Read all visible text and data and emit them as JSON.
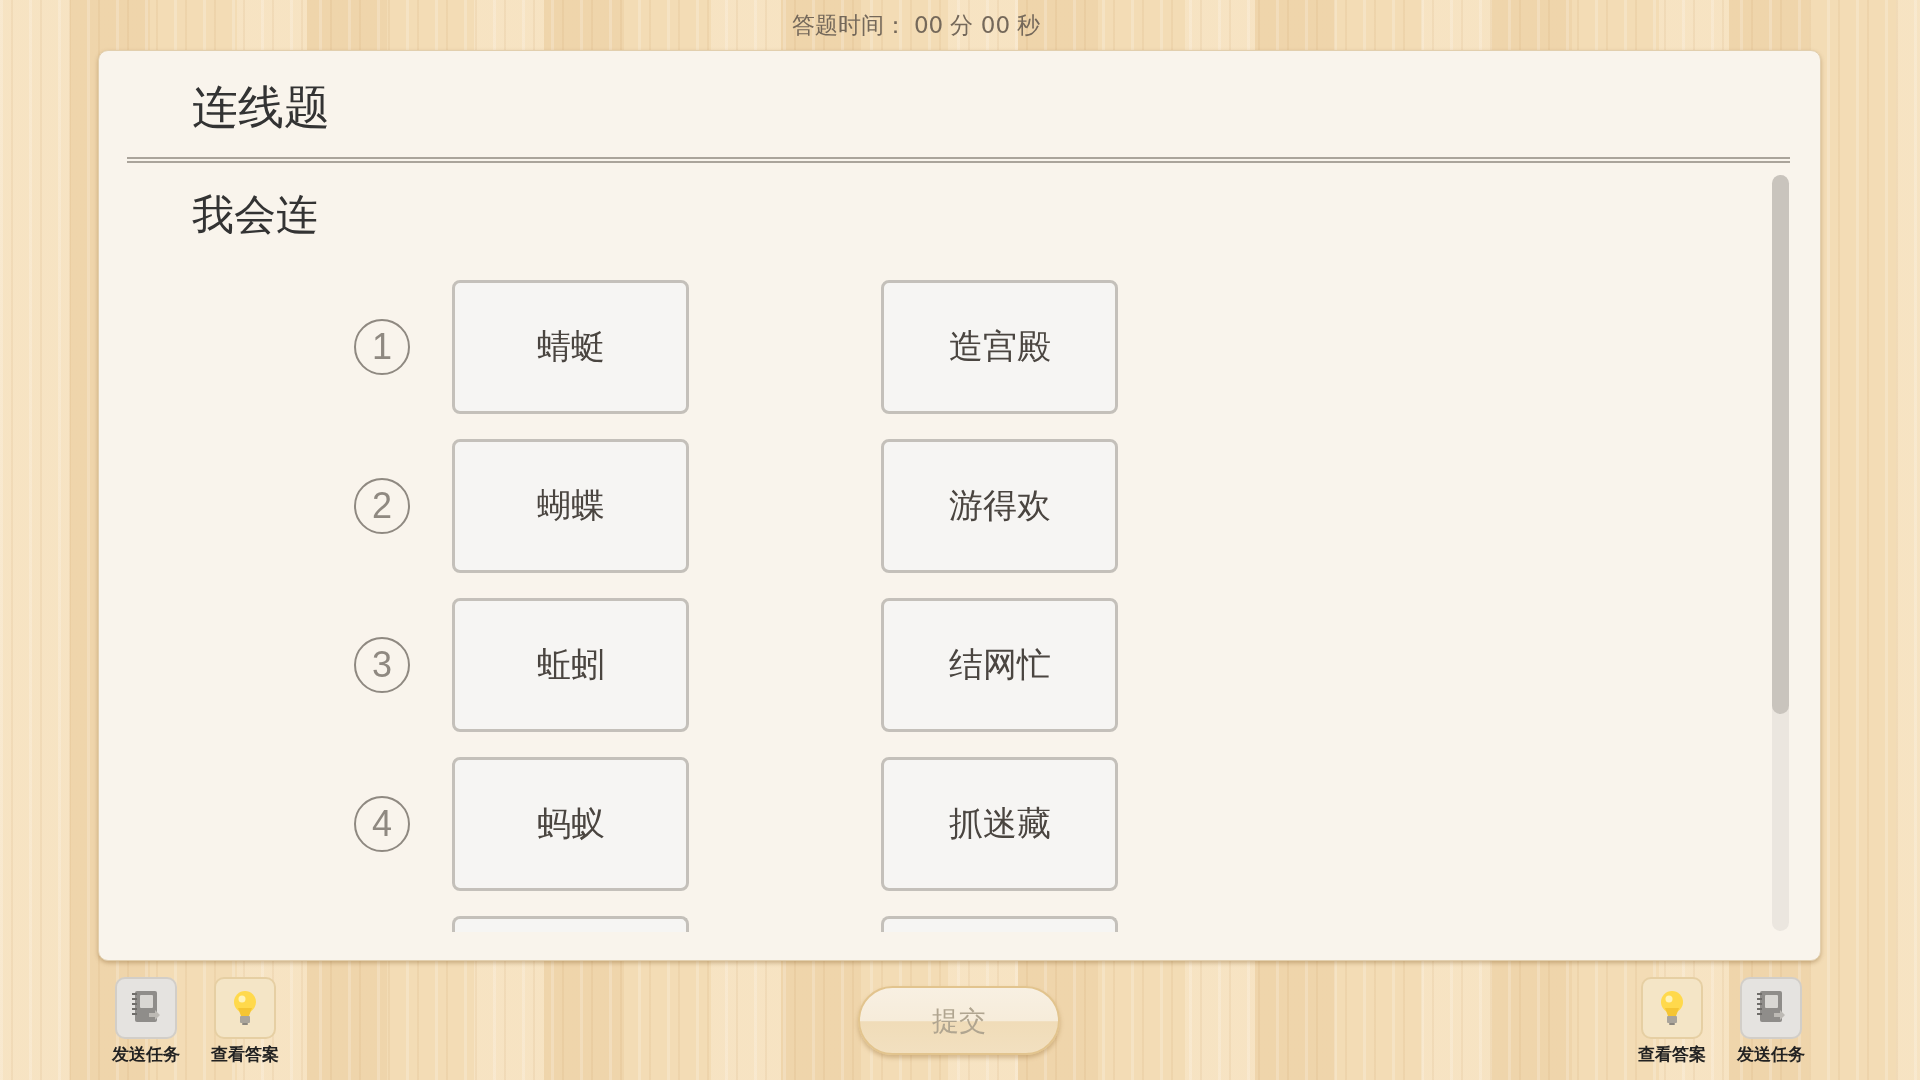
{
  "timer": "答题时间： 00 分 00 秒",
  "question": {
    "type_title": "连线题",
    "prompt": "我会连",
    "pairs": [
      {
        "number": "1",
        "left": {
          "text": "蜻蜓",
          "selected": false
        },
        "right": {
          "text": "造宫殿",
          "selected": false
        }
      },
      {
        "number": "2",
        "left": {
          "text": "蝴蝶",
          "selected": false
        },
        "right": {
          "text": "游得欢",
          "selected": false
        }
      },
      {
        "number": "3",
        "left": {
          "text": "蚯蚓",
          "selected": false
        },
        "right": {
          "text": "结网忙",
          "selected": false
        }
      },
      {
        "number": "4",
        "left": {
          "text": "蚂蚁",
          "selected": false
        },
        "right": {
          "text": "抓迷藏",
          "selected": false
        }
      }
    ],
    "more_below": true
  },
  "toolbar_left": [
    {
      "kind": "send_task",
      "label": "发送任务"
    },
    {
      "kind": "view_answer",
      "label": "查看答案"
    }
  ],
  "submit": {
    "label": "提交",
    "disabled": true
  },
  "toolbar_right": [
    {
      "kind": "view_answer",
      "label": "查看答案"
    },
    {
      "kind": "send_task",
      "label": "发送任务"
    }
  ]
}
